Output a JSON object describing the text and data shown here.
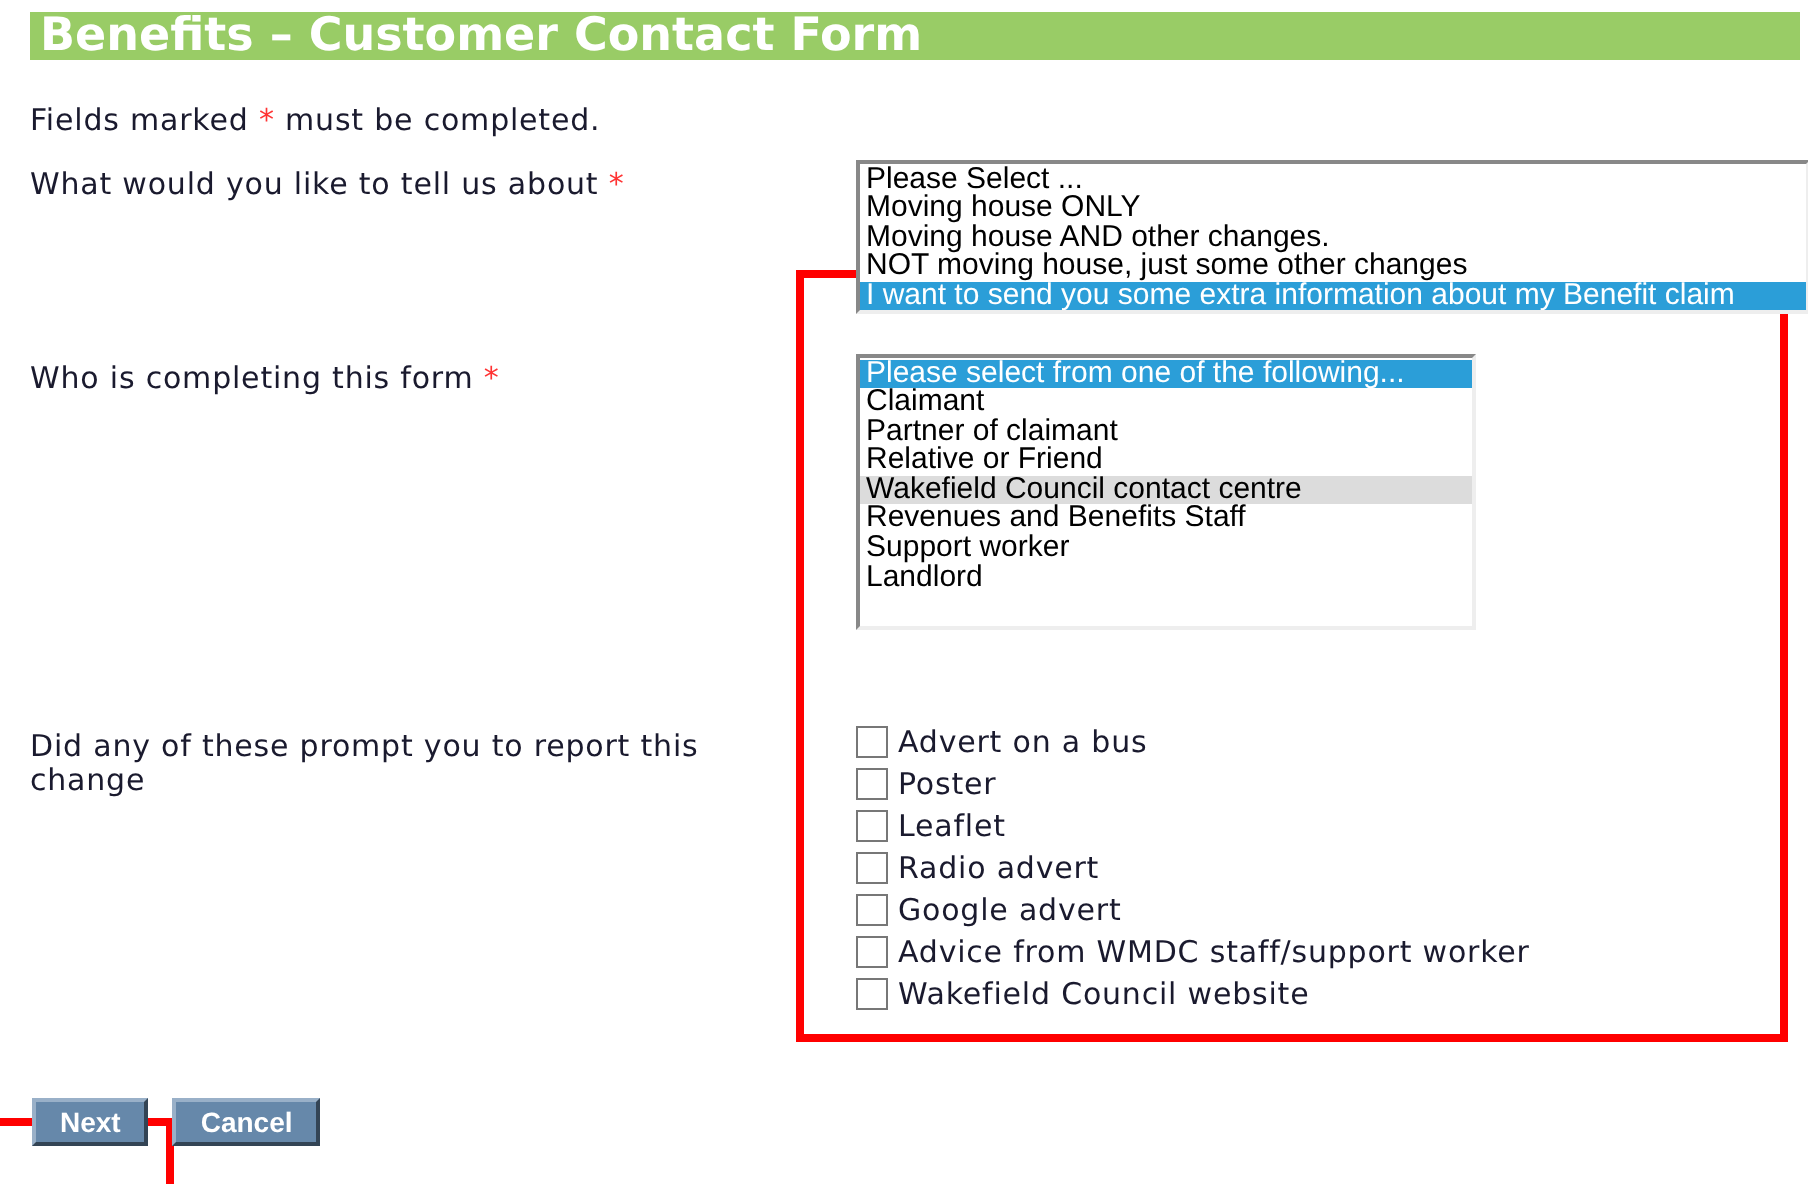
{
  "title": "Benefits – Customer Contact Form",
  "intro": {
    "text": "Fields marked",
    "mark": "*",
    "rest": "must be completed."
  },
  "questions": [
    {
      "kind": "listbox",
      "label": "What would you like to tell us about",
      "required": true,
      "options": [
        {
          "label": "Please Select ...",
          "selected": false,
          "hovered": false
        },
        {
          "label": "Moving house ONLY",
          "selected": false,
          "hovered": false
        },
        {
          "label": "Moving house AND other changes.",
          "selected": false,
          "hovered": false
        },
        {
          "label": "NOT moving house, just some other changes",
          "selected": false,
          "hovered": false
        },
        {
          "label": "I want to send you some extra information about my Benefit claim",
          "selected": true,
          "hovered": false
        }
      ]
    },
    {
      "kind": "listbox",
      "label": "Who is completing this form",
      "required": true,
      "options": [
        {
          "label": "Please select from one of the following...",
          "selected": true,
          "hovered": false
        },
        {
          "label": "Claimant",
          "selected": false,
          "hovered": false
        },
        {
          "label": "Partner of claimant",
          "selected": false,
          "hovered": false
        },
        {
          "label": "Relative or Friend",
          "selected": false,
          "hovered": false
        },
        {
          "label": "Wakefield Council contact centre",
          "selected": false,
          "hovered": true
        },
        {
          "label": "Revenues and Benefits Staff",
          "selected": false,
          "hovered": false
        },
        {
          "label": "Support worker",
          "selected": false,
          "hovered": false
        },
        {
          "label": "Landlord",
          "selected": false,
          "hovered": false
        }
      ]
    },
    {
      "kind": "checkboxes",
      "label": "Did any of these prompt you to report this change",
      "required": false,
      "options": [
        {
          "label": "Advert on a bus",
          "checked": false
        },
        {
          "label": "Poster",
          "checked": false
        },
        {
          "label": "Leaflet",
          "checked": false
        },
        {
          "label": "Radio advert",
          "checked": false
        },
        {
          "label": "Google advert",
          "checked": false
        },
        {
          "label": "Advice from WMDC staff/support worker",
          "checked": false
        },
        {
          "label": "Wakefield Council website",
          "checked": false
        }
      ]
    }
  ],
  "buttons": [
    {
      "label": "Next"
    },
    {
      "label": "Cancel"
    }
  ]
}
